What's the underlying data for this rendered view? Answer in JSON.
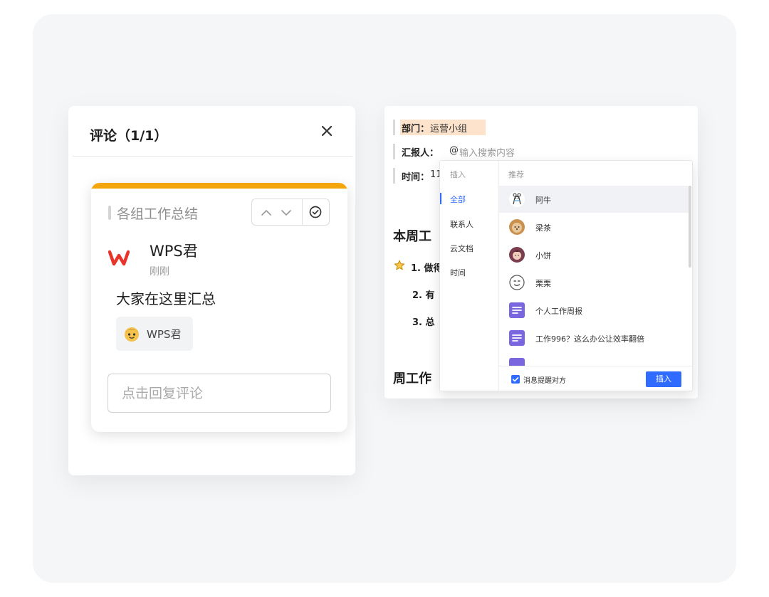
{
  "comment_panel": {
    "title": "评论（1/1）",
    "card": {
      "quote": "各组工作总结",
      "author": "WPS君",
      "time": "刚刚",
      "text": "大家在这里汇总",
      "mention": "WPS君",
      "reply_placeholder": "点击回复评论",
      "accent_color": "#f2a60c"
    }
  },
  "doc": {
    "fields": [
      {
        "label": "部门：",
        "value": "运营小组"
      },
      {
        "label": "汇报人：",
        "value": "@",
        "input": "输入搜索内容"
      },
      {
        "label": "时间：",
        "value": "11"
      }
    ],
    "heading1": "本周工",
    "items": [
      "1. 做得",
      "2. 有",
      "3. 总"
    ],
    "heading2": "周工作"
  },
  "mention_popup": {
    "sidebar_header": "插入",
    "sidebar_items": [
      "全部",
      "联系人",
      "云文档",
      "时间"
    ],
    "main_header": "推荐",
    "results": [
      {
        "label": "阿牛",
        "icon": "bear-sketch-avatar"
      },
      {
        "label": "梁茶",
        "icon": "puppy-avatar"
      },
      {
        "label": "小饼",
        "icon": "girl-avatar"
      },
      {
        "label": "栗栗",
        "icon": "cartoon-face-avatar"
      },
      {
        "label": "个人工作周报",
        "icon": "doc-icon"
      },
      {
        "label": "工作996？这么办公让效率翻倍",
        "icon": "doc-icon"
      }
    ],
    "notify_label": "消息提醒对方",
    "insert_label": "插入",
    "accent_color": "#2f6bff"
  }
}
